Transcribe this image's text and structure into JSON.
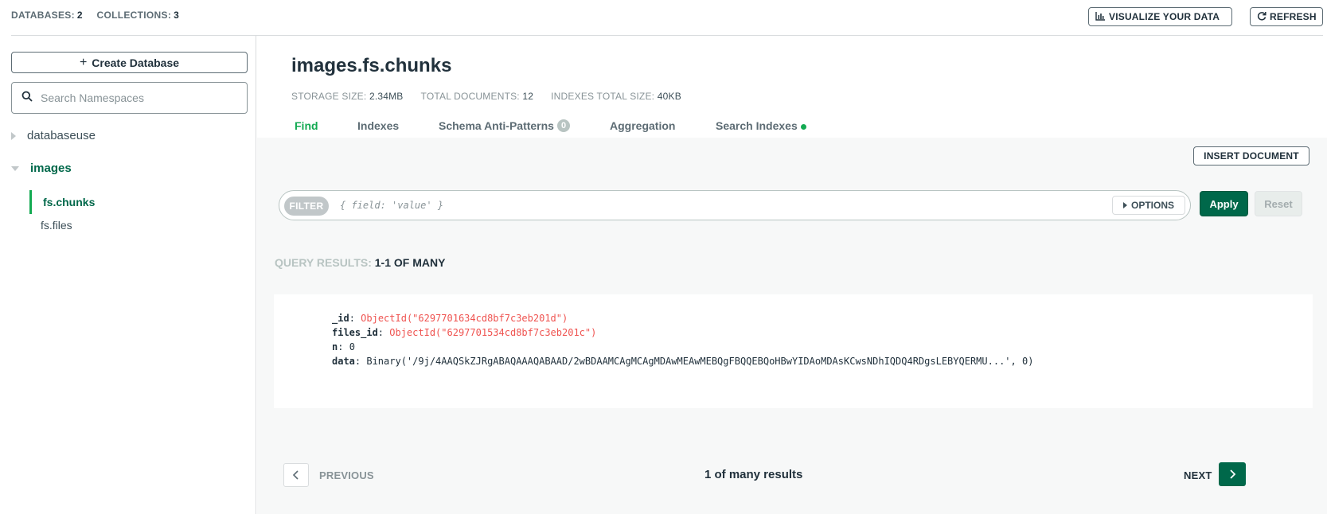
{
  "topbar": {
    "databases_label": "DATABASES:",
    "databases_count": "2",
    "collections_label": "COLLECTIONS:",
    "collections_count": "3",
    "visualize_label": "VISUALIZE YOUR DATA",
    "refresh_label": "REFRESH"
  },
  "sidebar": {
    "create_db_label": "Create Database",
    "search_placeholder": "Search Namespaces",
    "databases": [
      {
        "name": "databaseuse",
        "expanded": false
      },
      {
        "name": "images",
        "expanded": true,
        "collections": [
          "fs.chunks",
          "fs.files"
        ]
      }
    ],
    "active_collection": "fs.chunks"
  },
  "collection": {
    "title": "images.fs.chunks",
    "storage_size_label": "STORAGE SIZE:",
    "storage_size": "2.34MB",
    "total_documents_label": "TOTAL DOCUMENTS:",
    "total_documents": "12",
    "indexes_size_label": "INDEXES TOTAL SIZE:",
    "indexes_size": "40KB"
  },
  "tabs": [
    {
      "label": "Find",
      "active": true
    },
    {
      "label": "Indexes"
    },
    {
      "label": "Schema Anti-Patterns",
      "badge": "0"
    },
    {
      "label": "Aggregation"
    },
    {
      "label": "Search Indexes"
    }
  ],
  "query": {
    "insert_label": "INSERT DOCUMENT",
    "filter_label": "FILTER",
    "filter_placeholder": "{ field: 'value' }",
    "options_label": "OPTIONS",
    "apply_label": "Apply",
    "reset_label": "Reset",
    "results_label": "QUERY RESULTS:",
    "results_range": "1-1 OF MANY"
  },
  "document": {
    "fields": [
      {
        "key": "_id",
        "value": "ObjectId(\"6297701634cd8bf7c3eb201d\")",
        "kind": "oid"
      },
      {
        "key": "files_id",
        "value": "ObjectId(\"6297701534cd8bf7c3eb201c\")",
        "kind": "oid"
      },
      {
        "key": "n",
        "value": "0",
        "kind": "plain"
      },
      {
        "key": "data",
        "value": "Binary('/9j/4AAQSkZJRgABAQAAAQABAAD/2wBDAAMCAgMCAgMDAwMEAwMEBQgFBQQEBQoHBwYIDAoMDAsKCwsNDhIQDQ4RDgsLEBYQERMU...', 0)",
        "kind": "plain"
      }
    ]
  },
  "pager": {
    "previous_label": "PREVIOUS",
    "summary": "1 of many results",
    "next_label": "NEXT"
  },
  "colors": {
    "brand_green": "#00684a",
    "accent_green": "#13aa52",
    "oid_red": "#ef5350"
  }
}
